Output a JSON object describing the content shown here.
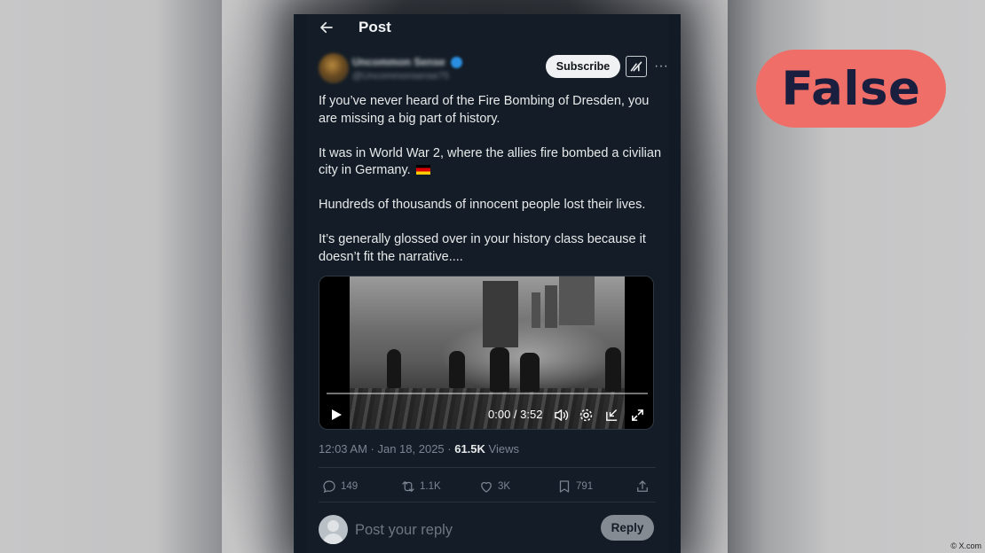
{
  "header": {
    "title": "Post"
  },
  "author": {
    "name_blurred": "Uncommon Sense",
    "handle_blurred": "@Uncommonsense75",
    "subscribe_label": "Subscribe"
  },
  "post": {
    "paragraphs": [
      "If you’ve never heard of the Fire Bombing of Dresden, you are missing a big part of history.",
      "It was in World War 2, where the allies fire bombed a civilian city in Germany.",
      "Hundreds of thousands of innocent people lost their lives.",
      "It’s generally glossed over in your history class because it doesn’t fit the narrative...."
    ],
    "flag_emoji": "germany-flag"
  },
  "video": {
    "time": "0:00 / 3:52",
    "progress_fraction": 0.0
  },
  "meta": {
    "timestamp": "12:03 AM · Jan 18, 2025 · ",
    "views_count": "61.5K",
    "views_label": " Views"
  },
  "actions": {
    "replies": "149",
    "reposts": "1.1K",
    "likes": "3K",
    "bookmarks": "791"
  },
  "reply": {
    "placeholder": "Post your reply",
    "button_label": "Reply"
  },
  "overlay": {
    "verdict": "False",
    "verdict_color": "#ef6e67",
    "credit": "© X.com"
  },
  "colors": {
    "background_dark": "#141d27",
    "text_primary": "#e7e9ea",
    "text_muted": "#7a8591"
  }
}
